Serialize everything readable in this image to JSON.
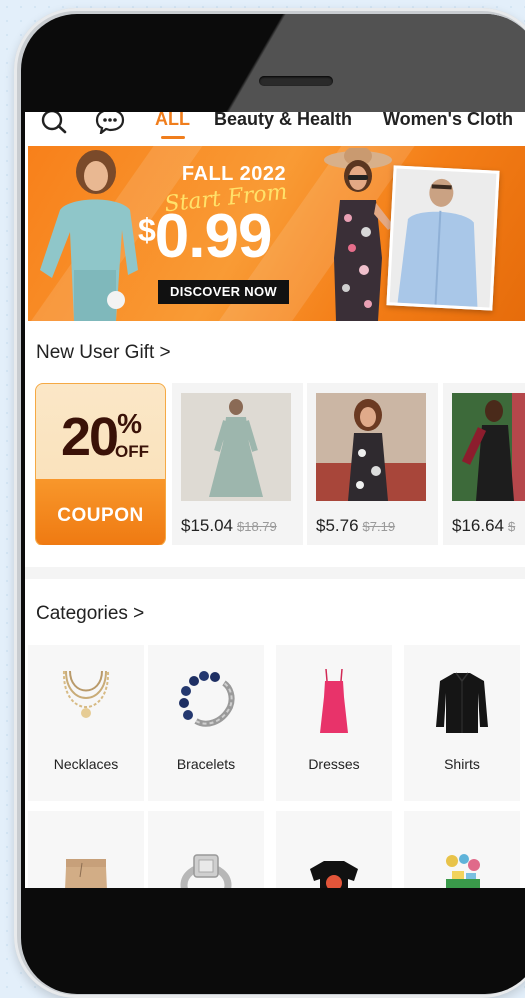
{
  "top_nav": {
    "tabs": [
      "ALL",
      "Beauty & Health",
      "Women's Cloth"
    ],
    "active_tab": "ALL"
  },
  "banner": {
    "title": "FALL 2022",
    "subtitle": "Start From",
    "currency": "$",
    "price": "0.99",
    "cta": "DISCOVER NOW"
  },
  "new_user_gift": {
    "heading": "New User Gift >",
    "coupon": {
      "percent": "20",
      "percent_sign": "%",
      "off": "OFF",
      "label": "COUPON"
    },
    "products": [
      {
        "price": "$15.04",
        "old_price": "$18.79"
      },
      {
        "price": "$5.76",
        "old_price": "$7.19"
      },
      {
        "price": "$16.64",
        "old_price": "$"
      }
    ]
  },
  "categories": {
    "heading": "Categories >",
    "items": [
      "Necklaces",
      "Bracelets",
      "Dresses",
      "Shirts"
    ]
  },
  "colors": {
    "accent": "#f07e1d",
    "text": "#222222",
    "strike": "#9a9a9a"
  },
  "icons": [
    "search-icon",
    "chat-icon",
    "necklace-icon",
    "bracelet-icon",
    "dress-icon",
    "shirt-icon",
    "shorts-icon",
    "ring-icon",
    "tshirt-icon",
    "toy-icon"
  ]
}
